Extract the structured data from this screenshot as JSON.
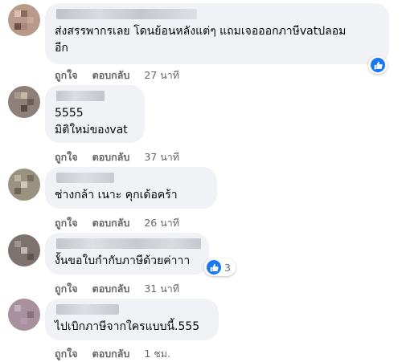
{
  "comments": [
    {
      "text": "ส่งสรรพากรเลย โดนย้อนหลังแต่ๆ แถมเจอออกภาษีvatปลอม\nอีก",
      "like_label": "ถูกใจ",
      "reply_label": "ตอบกลับ",
      "time": "27 นาที",
      "reaction_count": ""
    },
    {
      "text": "5555\nมิติใหม่ของvat",
      "like_label": "ถูกใจ",
      "reply_label": "ตอบกลับ",
      "time": "37 นาที",
      "reaction_count": ""
    },
    {
      "text": "ช่างกล้า เนาะ คุกเด้อคร้า",
      "like_label": "ถูกใจ",
      "reply_label": "ตอบกลับ",
      "time": "26 นาที",
      "reaction_count": ""
    },
    {
      "text": "งั้นขอใบกำกับภาษีด้วยค่าาา",
      "like_label": "ถูกใจ",
      "reply_label": "ตอบกลับ",
      "time": "31 นาที",
      "reaction_count": "3"
    },
    {
      "text": "ไปเบิกภาษีจากใครแบบนี้.555",
      "like_label": "ถูกใจ",
      "reply_label": "ตอบกลับ",
      "time": "1 ชม.",
      "reaction_count": ""
    }
  ],
  "colors": {
    "bubble": "#f0f2f5",
    "meta": "#65676b",
    "like": "#1877f2"
  }
}
